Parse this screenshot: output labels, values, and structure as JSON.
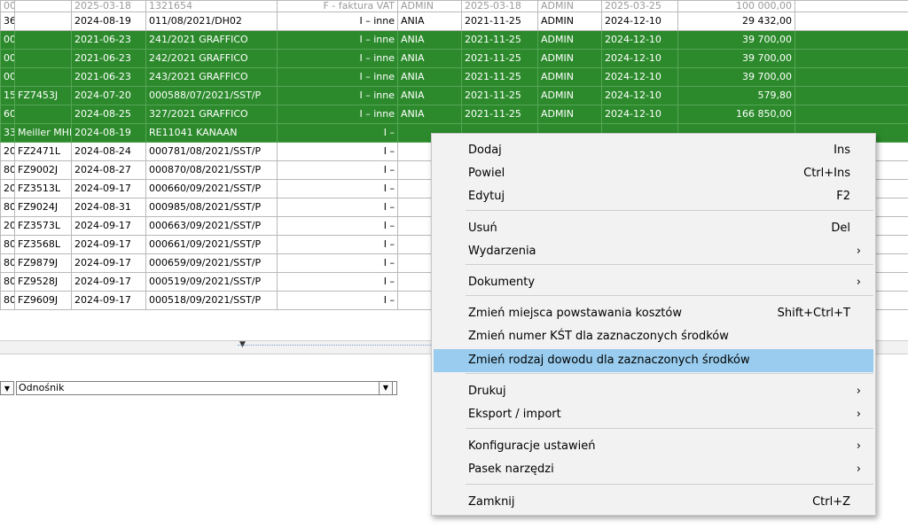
{
  "table": {
    "rows": [
      {
        "c0": "00",
        "c1": "",
        "c2": "2025-03-18",
        "c3": "1321654",
        "c4": "F - faktura VAT",
        "c5": "ADMIN",
        "c6": "2025-03-18",
        "c7": "ADMIN",
        "c8": "2025-03-25",
        "c9": "100 000,00",
        "style": "first"
      },
      {
        "c0": "36",
        "c1": "",
        "c2": "2024-08-19",
        "c3": "011/08/2021/DH02",
        "c4": "I – inne",
        "c5": "ANIA",
        "c6": "2021-11-25",
        "c7": "ADMIN",
        "c8": "2024-12-10",
        "c9": "29 432,00",
        "style": "white"
      },
      {
        "c0": "00",
        "c1": "",
        "c2": "2021-06-23",
        "c3": "241/2021 GRAFFICO",
        "c4": "I – inne",
        "c5": "ANIA",
        "c6": "2021-11-25",
        "c7": "ADMIN",
        "c8": "2024-12-10",
        "c9": "39 700,00",
        "style": "green"
      },
      {
        "c0": "00",
        "c1": "",
        "c2": "2021-06-23",
        "c3": "242/2021 GRAFFICO",
        "c4": "I – inne",
        "c5": "ANIA",
        "c6": "2021-11-25",
        "c7": "ADMIN",
        "c8": "2024-12-10",
        "c9": "39 700,00",
        "style": "green"
      },
      {
        "c0": "00",
        "c1": "",
        "c2": "2021-06-23",
        "c3": "243/2021 GRAFFICO",
        "c4": "I – inne",
        "c5": "ANIA",
        "c6": "2021-11-25",
        "c7": "ADMIN",
        "c8": "2024-12-10",
        "c9": "39 700,00",
        "style": "green"
      },
      {
        "c0": "15",
        "c1": "FZ7453J",
        "c2": "2024-07-20",
        "c3": "000588/07/2021/SST/P",
        "c4": "I – inne",
        "c5": "ANIA",
        "c6": "2021-11-25",
        "c7": "ADMIN",
        "c8": "2024-12-10",
        "c9": "579,80",
        "style": "green"
      },
      {
        "c0": "60",
        "c1": "",
        "c2": "2024-08-25",
        "c3": "327/2021 GRAFFICO",
        "c4": "I – inne",
        "c5": "ANIA",
        "c6": "2021-11-25",
        "c7": "ADMIN",
        "c8": "2024-12-10",
        "c9": "166 850,00",
        "style": "green"
      },
      {
        "c0": "33",
        "c1": "Meiller MHK",
        "c2": "2024-08-19",
        "c3": "RE11041 KANAAN",
        "c4": "I –",
        "c5": "",
        "c6": "",
        "c7": "",
        "c8": "",
        "c9": "",
        "style": "green"
      },
      {
        "c0": "20",
        "c1": "FZ2471L",
        "c2": "2024-08-24",
        "c3": "000781/08/2021/SST/P",
        "c4": "I –",
        "c5": "",
        "c6": "",
        "c7": "",
        "c8": "",
        "c9": "",
        "style": "white"
      },
      {
        "c0": "80",
        "c1": "FZ9002J",
        "c2": "2024-08-27",
        "c3": "000870/08/2021/SST/P",
        "c4": "I –",
        "c5": "",
        "c6": "",
        "c7": "",
        "c8": "",
        "c9": "",
        "style": "white"
      },
      {
        "c0": "20",
        "c1": "FZ3513L",
        "c2": "2024-09-17",
        "c3": "000660/09/2021/SST/P",
        "c4": "I –",
        "c5": "",
        "c6": "",
        "c7": "",
        "c8": "",
        "c9": "",
        "style": "white"
      },
      {
        "c0": "80",
        "c1": "FZ9024J",
        "c2": "2024-08-31",
        "c3": "000985/08/2021/SST/P",
        "c4": "I –",
        "c5": "",
        "c6": "",
        "c7": "",
        "c8": "",
        "c9": "",
        "style": "white"
      },
      {
        "c0": "20",
        "c1": "FZ3573L",
        "c2": "2024-09-17",
        "c3": "000663/09/2021/SST/P",
        "c4": "I –",
        "c5": "",
        "c6": "",
        "c7": "",
        "c8": "",
        "c9": "",
        "style": "white"
      },
      {
        "c0": "80",
        "c1": "FZ3568L",
        "c2": "2024-09-17",
        "c3": "000661/09/2021/SST/P",
        "c4": "I –",
        "c5": "",
        "c6": "",
        "c7": "",
        "c8": "",
        "c9": "",
        "style": "white"
      },
      {
        "c0": "80",
        "c1": "FZ9879J",
        "c2": "2024-09-17",
        "c3": "000659/09/2021/SST/P",
        "c4": "I –",
        "c5": "",
        "c6": "",
        "c7": "",
        "c8": "",
        "c9": "",
        "style": "white"
      },
      {
        "c0": "80",
        "c1": "FZ9528J",
        "c2": "2024-09-17",
        "c3": "000519/09/2021/SST/P",
        "c4": "I –",
        "c5": "",
        "c6": "",
        "c7": "",
        "c8": "",
        "c9": "",
        "style": "white"
      },
      {
        "c0": "80",
        "c1": "FZ9609J",
        "c2": "2024-09-17",
        "c3": "000518/09/2021/SST/P",
        "c4": "I –",
        "c5": "",
        "c6": "",
        "c7": "",
        "c8": "",
        "c9": "",
        "style": "white"
      }
    ]
  },
  "filter": {
    "reference_label": "Odnośnik"
  },
  "context_menu": {
    "items": [
      {
        "label": "Dodaj",
        "shortcut": "Ins",
        "submenu": false
      },
      {
        "label": "Powiel",
        "shortcut": "Ctrl+Ins",
        "submenu": false
      },
      {
        "label": "Edytuj",
        "shortcut": "F2",
        "submenu": false
      },
      {
        "label": "Usuń",
        "shortcut": "Del",
        "submenu": false
      },
      {
        "label": "Wydarzenia",
        "shortcut": "",
        "submenu": true
      },
      {
        "label": "Dokumenty",
        "shortcut": "",
        "submenu": true
      },
      {
        "label": "Zmień miejsca powstawania kosztów",
        "shortcut": "Shift+Ctrl+T",
        "submenu": false
      },
      {
        "label": "Zmień numer KŚT dla zaznaczonych środków",
        "shortcut": "",
        "submenu": false
      },
      {
        "label": "Zmień rodzaj dowodu dla zaznaczonych środków",
        "shortcut": "",
        "submenu": false,
        "highlighted": true
      },
      {
        "label": "Drukuj",
        "shortcut": "",
        "submenu": true
      },
      {
        "label": "Eksport / import",
        "shortcut": "",
        "submenu": true
      },
      {
        "label": "Konfiguracje ustawień",
        "shortcut": "",
        "submenu": true
      },
      {
        "label": "Pasek narzędzi",
        "shortcut": "",
        "submenu": true
      },
      {
        "label": "Zamknij",
        "shortcut": "Ctrl+Z",
        "submenu": false
      }
    ],
    "submenu_glyph": "›"
  },
  "colors": {
    "selected_row": "#2c8a2c",
    "menu_highlight": "#99ccee"
  }
}
